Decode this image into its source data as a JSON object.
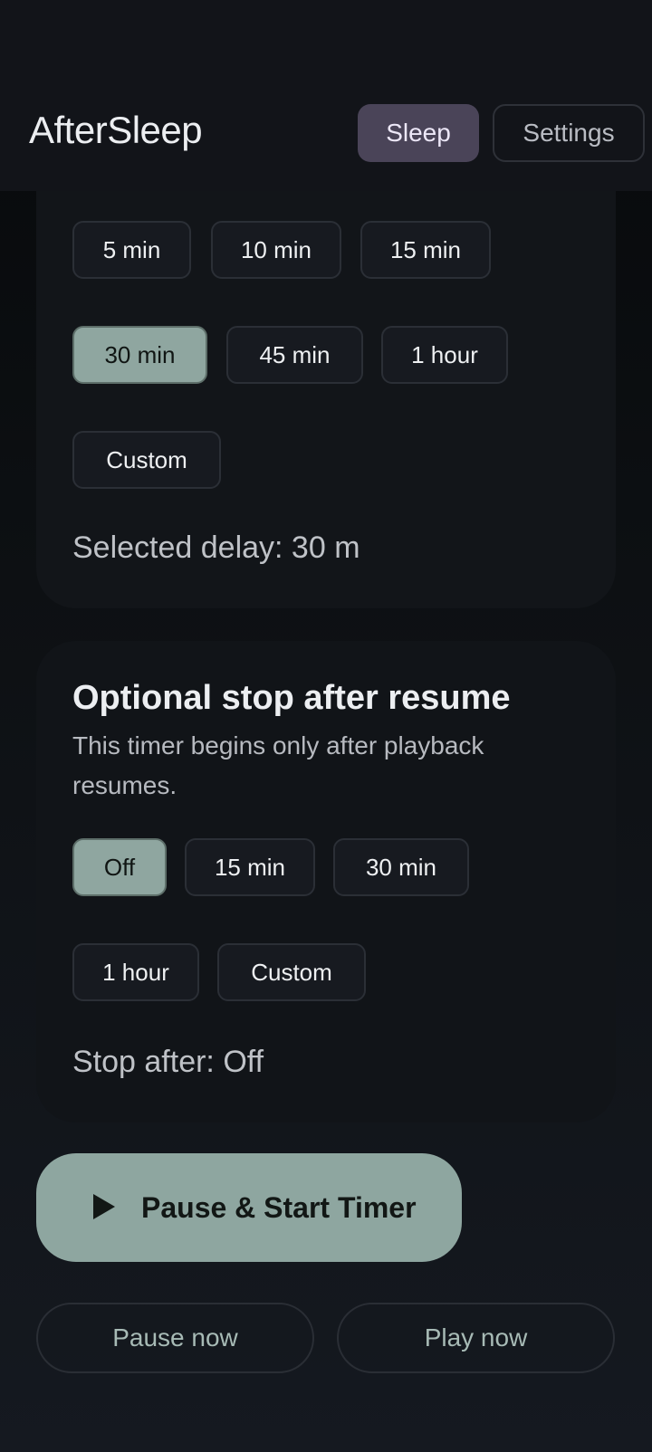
{
  "app": {
    "title": "AfterSleep"
  },
  "nav": {
    "sleep_label": "Sleep",
    "settings_label": "Settings",
    "active": "Sleep"
  },
  "delay_card": {
    "options": [
      "5 min",
      "10 min",
      "15 min",
      "30 min",
      "45 min",
      "1 hour",
      "Custom"
    ],
    "selected": "30 min",
    "status": "Selected delay: 30 m"
  },
  "stop_card": {
    "title": "Optional stop after resume",
    "description": "This timer begins only after playback resumes.",
    "options": [
      "Off",
      "15 min",
      "30 min",
      "1 hour",
      "Custom"
    ],
    "selected": "Off",
    "status": "Stop after: Off"
  },
  "actions": {
    "primary_label": "Pause & Start Timer",
    "primary_icon": "play-icon",
    "pause_now_label": "Pause now",
    "play_now_label": "Play now"
  },
  "colors": {
    "accent": "#8ea6a0",
    "nav_active": "#4a4458",
    "background": "#121419"
  }
}
